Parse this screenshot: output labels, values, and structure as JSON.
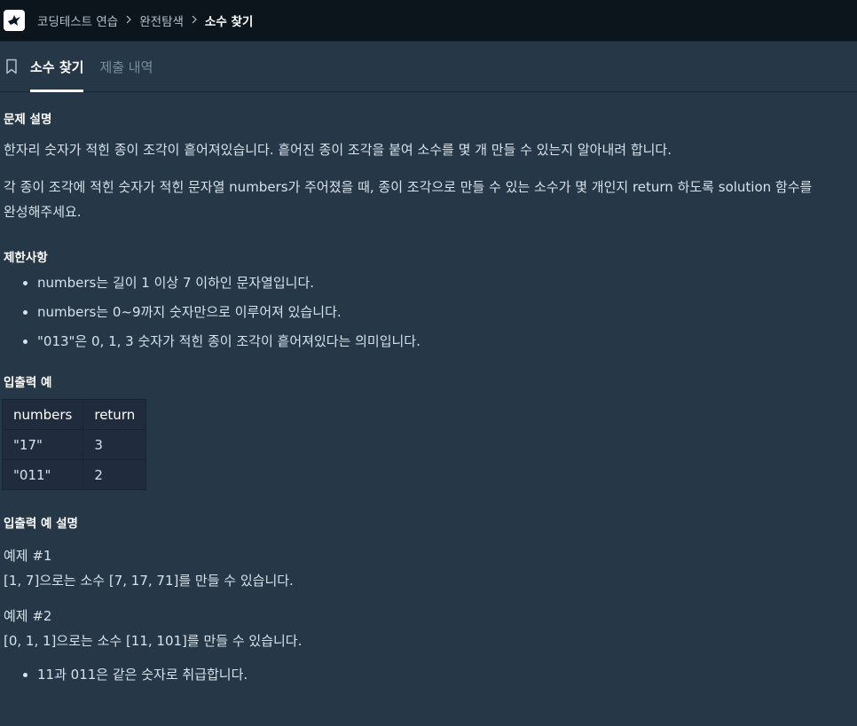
{
  "breadcrumb": {
    "items": [
      "코딩테스트 연습",
      "완전탐색"
    ],
    "current": "소수 찾기"
  },
  "tabs": {
    "active": "소수 찾기",
    "inactive": "제출 내역"
  },
  "problem": {
    "heading": "문제 설명",
    "para1": "한자리 숫자가 적힌 종이 조각이 흩어져있습니다. 흩어진 종이 조각을 붙여 소수를 몇 개 만들 수 있는지 알아내려 합니다.",
    "para2_line1": "각 종이 조각에 적힌 숫자가 적힌 문자열 numbers가 주어졌을 때, 종이 조각으로 만들 수 있는 소수가 몇 개인지 return 하도록 solution 함수를",
    "para2_line2": "완성해주세요."
  },
  "constraints": {
    "heading": "제한사항",
    "items": [
      "numbers는 길이 1 이상 7 이하인 문자열입니다.",
      "numbers는 0~9까지 숫자만으로 이루어져 있습니다.",
      "\"013\"은 0, 1, 3 숫자가 적힌 종이 조각이 흩어져있다는 의미입니다."
    ]
  },
  "examples": {
    "heading": "입출력 예",
    "headers": [
      "numbers",
      "return"
    ],
    "rows": [
      [
        "\"17\"",
        "3"
      ],
      [
        "\"011\"",
        "2"
      ]
    ]
  },
  "explanation": {
    "heading": "입출력 예 설명",
    "ex1_title": "예제 #1",
    "ex1_text": "[1, 7]으로는 소수 [7, 17, 71]를 만들 수 있습니다.",
    "ex2_title": "예제 #2",
    "ex2_text": "[0, 1, 1]으로는 소수 [11, 101]를 만들 수 있습니다.",
    "bullets": [
      "11과 011은 같은 숫자로 취급합니다."
    ]
  },
  "icons": {
    "logo": "bird-logo-icon",
    "bookmark": "bookmark-icon",
    "separator": "chevron-right-icon"
  }
}
